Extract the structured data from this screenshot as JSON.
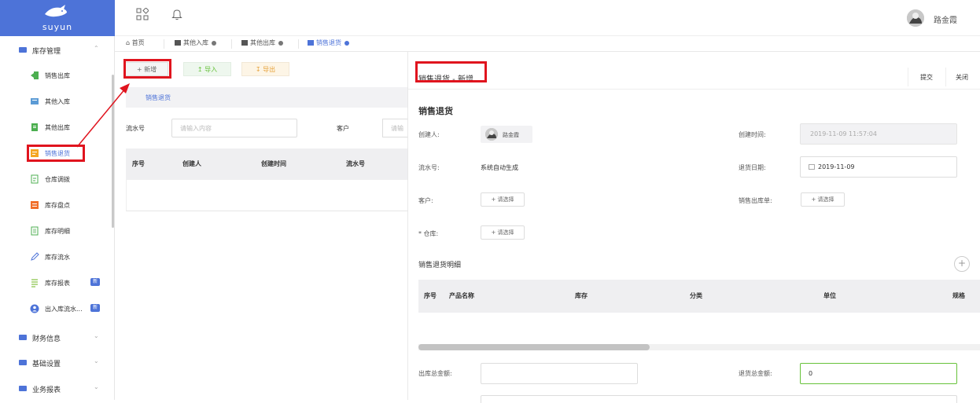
{
  "brand": {
    "name": "suyun"
  },
  "header": {
    "user_name": "路金霞"
  },
  "sidebar": {
    "group_inventory": "库存管理",
    "items": [
      {
        "label": "销售出库"
      },
      {
        "label": "其他入库"
      },
      {
        "label": "其他出库"
      },
      {
        "label": "销售退货"
      },
      {
        "label": "仓库调拨"
      },
      {
        "label": "库存盘点"
      },
      {
        "label": "库存明细"
      },
      {
        "label": "库存流水"
      },
      {
        "label": "库存报表",
        "badge": "新"
      },
      {
        "label": "出入库流水...",
        "badge": "新"
      }
    ],
    "group_finance": "财务信息",
    "group_basic": "基础设置",
    "group_report": "业务报表"
  },
  "tabs": [
    {
      "label": "首页"
    },
    {
      "label": "其他入库"
    },
    {
      "label": "其他出库"
    },
    {
      "label": "销售退货"
    }
  ],
  "toolbar": {
    "add": "+ 新增",
    "import": "导入",
    "export": "导出"
  },
  "list": {
    "title": "销售退货",
    "flow_label": "流水号",
    "flow_placeholder": "请输入内容",
    "customer_label": "客户",
    "customer_placeholder": "请输",
    "columns": [
      "序号",
      "创建人",
      "创建时间",
      "流水号"
    ]
  },
  "form": {
    "title": "销售退货  -  新增",
    "submit": "提交",
    "close": "关闭",
    "section": "销售退货",
    "creator_label": "创建人:",
    "creator_name": "路金霞",
    "created_time_label": "创建时间:",
    "created_time": "2019-11-09 11:57:04",
    "flow_label": "流水号:",
    "flow_value": "系统自动生成",
    "return_date_label": "退货日期:",
    "return_date": "2019-11-09",
    "customer_label": "客户:",
    "select_btn": "+ 请选择",
    "sales_order_label": "销售出库单:",
    "warehouse_label": "* 仓库:",
    "detail_title": "销售退货明细",
    "detail_columns": [
      "序号",
      "产品名称",
      "库存",
      "分类",
      "单位",
      "规格"
    ],
    "out_total_label": "出库总金额:",
    "return_total_label": "退货总金额:",
    "return_total_value": "0"
  },
  "colors": {
    "accent": "#4d73d8",
    "annotation": "#e0141e",
    "success": "#67c23a",
    "warning": "#e6a23c"
  }
}
